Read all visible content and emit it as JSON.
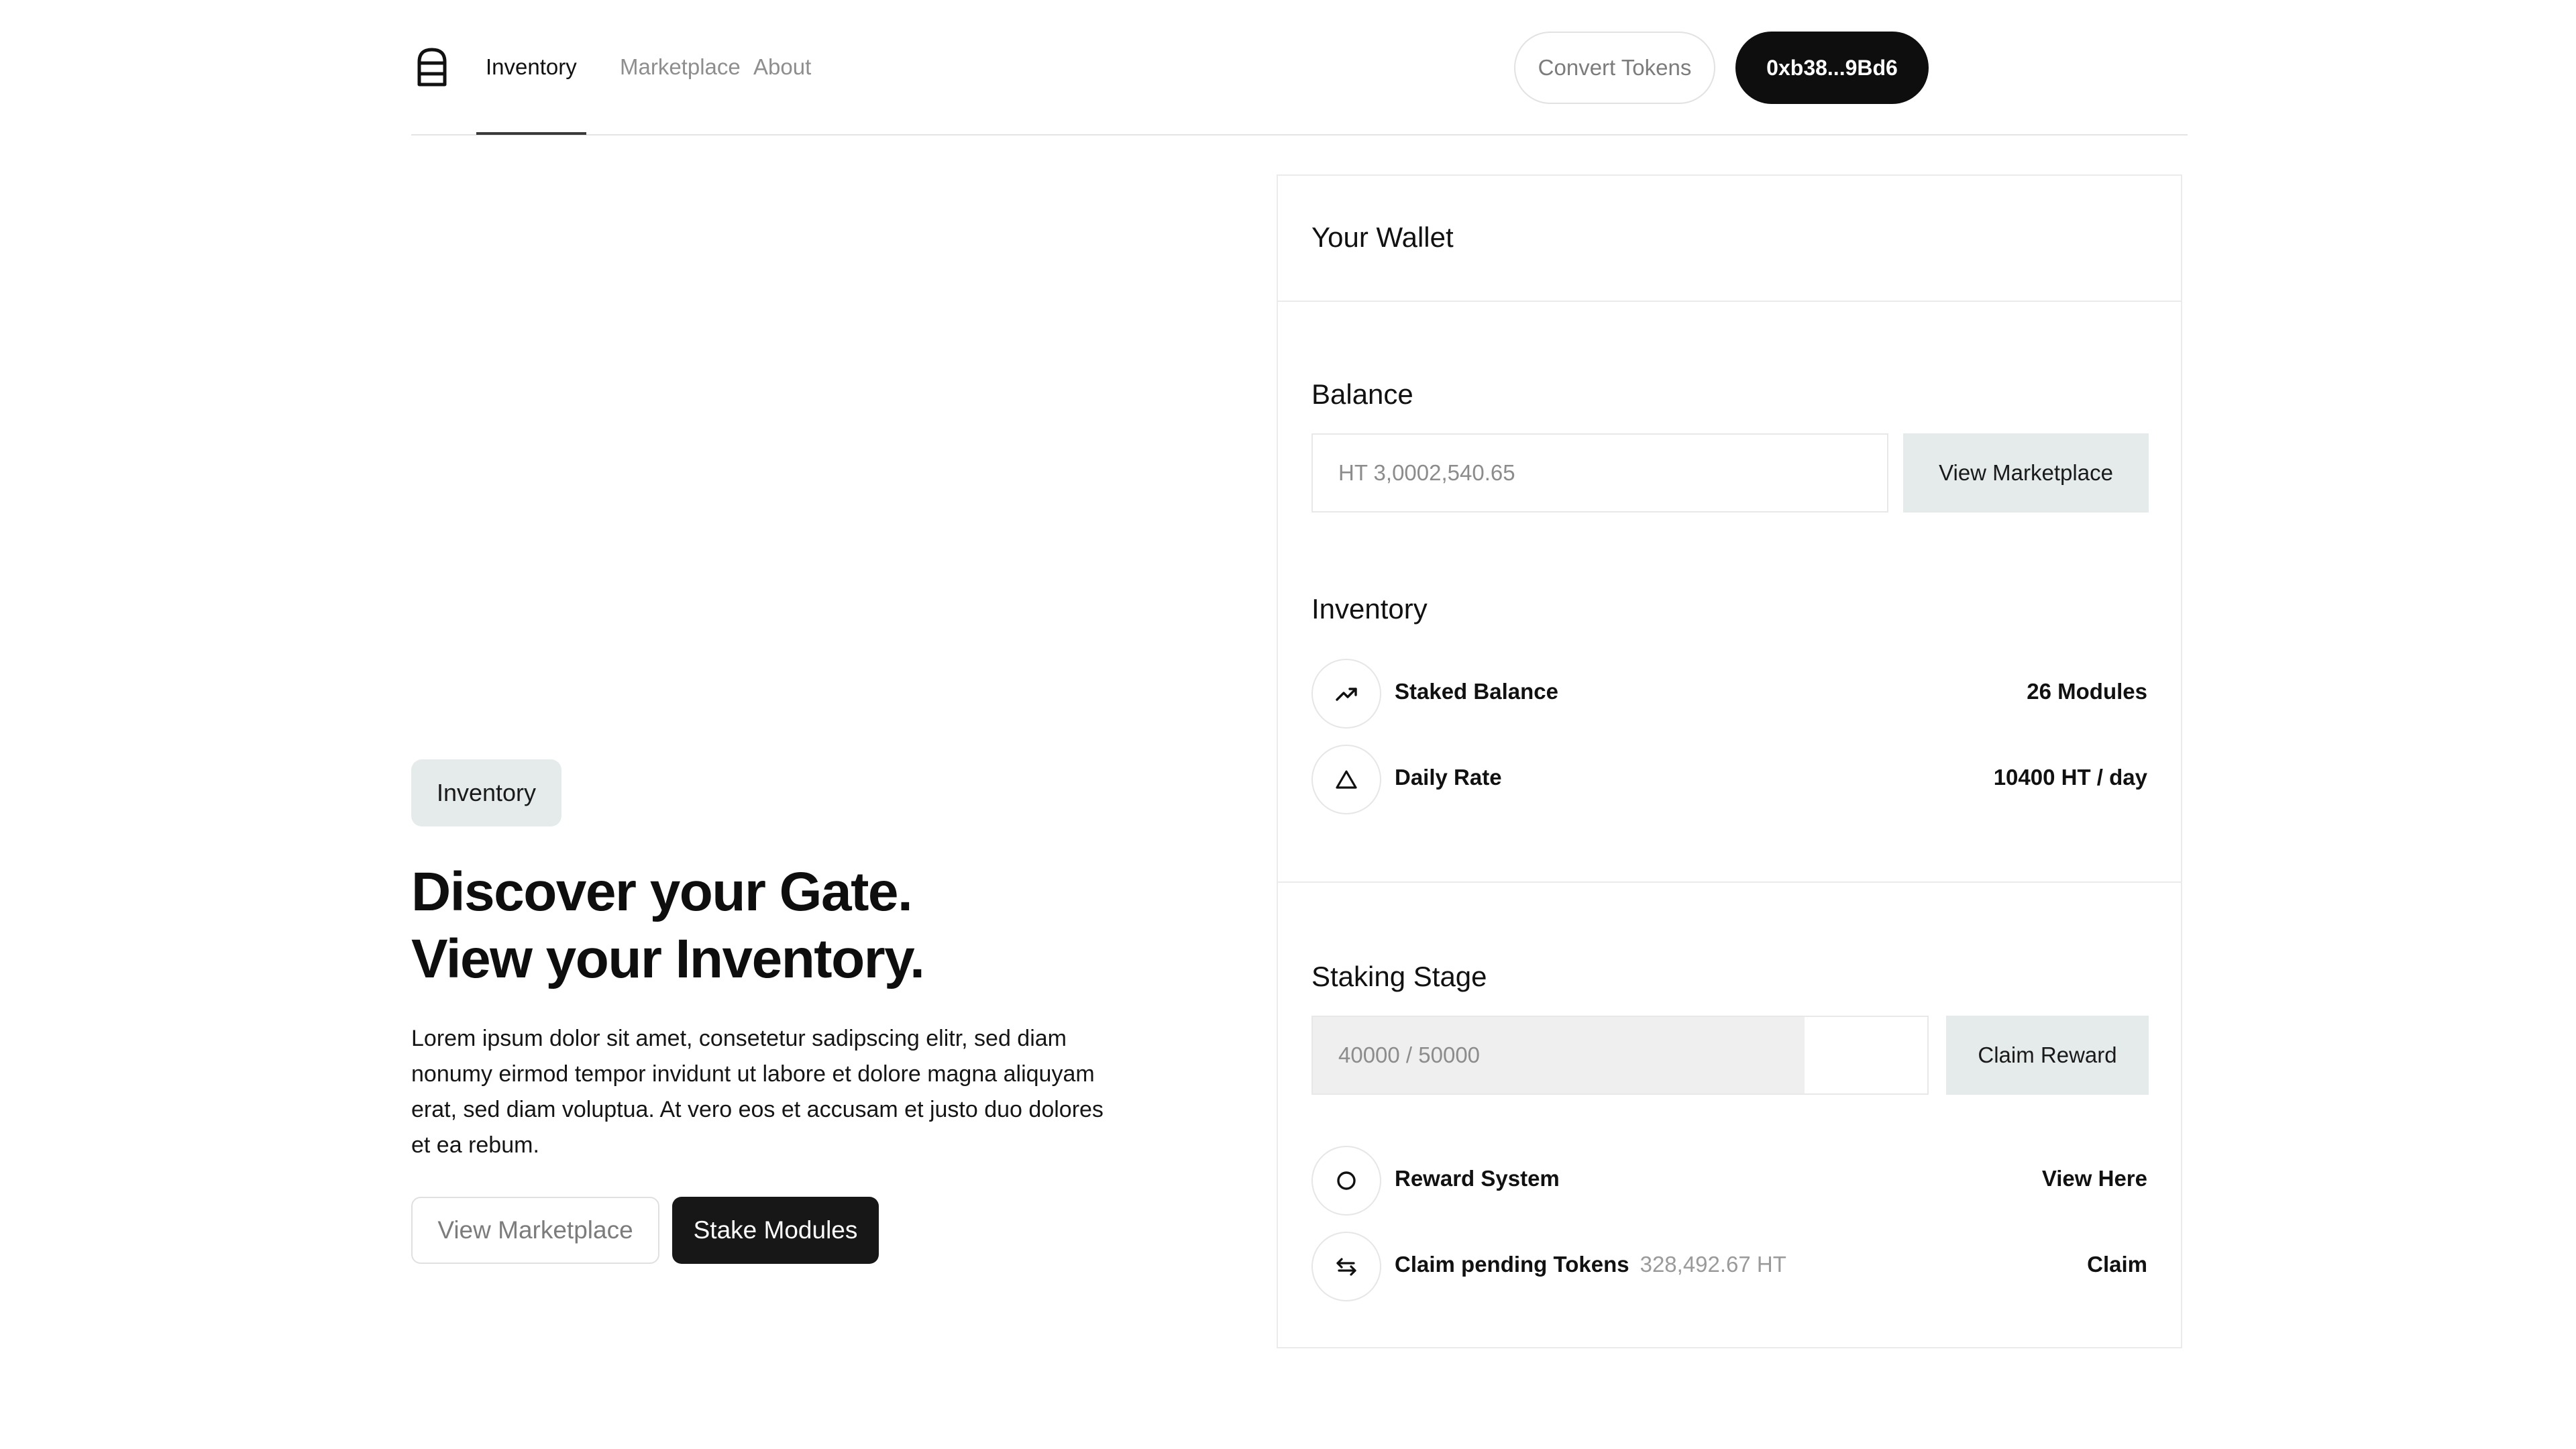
{
  "header": {
    "nav": [
      {
        "label": "Inventory",
        "active": true
      },
      {
        "label": "Marketplace",
        "active": false
      },
      {
        "label": "About",
        "active": false
      }
    ],
    "convert_label": "Convert Tokens",
    "wallet_address": "0xb38...9Bd6"
  },
  "hero": {
    "badge": "Inventory",
    "title_line1": "Discover your Gate.",
    "title_line2": "View your Inventory.",
    "description": "Lorem ipsum dolor sit amet, consetetur sadipscing elitr, sed diam nonumy eirmod tempor invidunt ut labore et dolore magna aliquyam erat, sed diam voluptua. At vero eos et accusam et justo duo dolores et ea rebum.",
    "secondary_button": "View Marketplace",
    "primary_button": "Stake Modules"
  },
  "wallet": {
    "title": "Your Wallet",
    "balance": {
      "heading": "Balance",
      "value": "HT 3,0002,540.65",
      "button": "View Marketplace"
    },
    "inventory": {
      "heading": "Inventory",
      "rows": [
        {
          "icon": "trending-up-icon",
          "label": "Staked Balance",
          "value": "26 Modules"
        },
        {
          "icon": "triangle-icon",
          "label": "Daily Rate",
          "value": "10400 HT / day"
        }
      ]
    },
    "staking": {
      "heading": "Staking Stage",
      "progress_text": "40000 / 50000",
      "progress_fraction": 0.8,
      "button": "Claim Reward",
      "rows": [
        {
          "icon": "circle-icon",
          "label": "Reward System",
          "extra": "",
          "action": "View Here"
        },
        {
          "icon": "swap-arrows-icon",
          "label": "Claim pending Tokens",
          "extra": "328,492.67 HT",
          "action": "Claim"
        }
      ]
    }
  },
  "colors": {
    "accent_soft": "#e4ebea",
    "dark": "#0e0e0e",
    "muted_text": "#8e8e8e"
  }
}
